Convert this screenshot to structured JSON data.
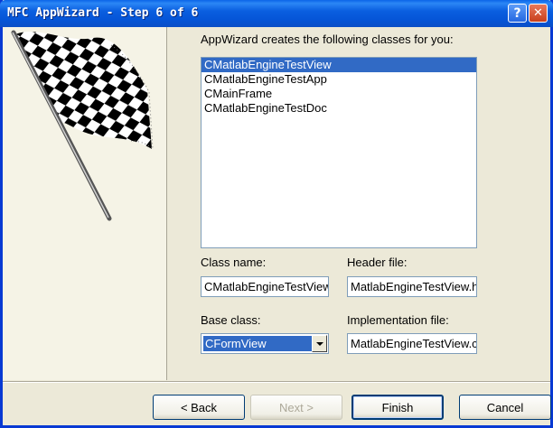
{
  "window": {
    "title": "MFC AppWizard - Step 6 of 6",
    "help_glyph": "?",
    "close_glyph": "✕"
  },
  "main": {
    "intro_text": "AppWizard creates the following classes for you:",
    "classes": [
      {
        "name": "CMatlabEngineTestView",
        "selected": true
      },
      {
        "name": "CMatlabEngineTestApp",
        "selected": false
      },
      {
        "name": "CMainFrame",
        "selected": false
      },
      {
        "name": "CMatlabEngineTestDoc",
        "selected": false
      }
    ],
    "class_name_label": "Class name:",
    "class_name_value": "CMatlabEngineTestView",
    "header_file_label": "Header file:",
    "header_file_value": "MatlabEngineTestView.h",
    "base_class_label": "Base class:",
    "base_class_value": "CFormView",
    "implementation_file_label": "Implementation file:",
    "implementation_file_value": "MatlabEngineTestView.cpp"
  },
  "buttons": {
    "back": "< Back",
    "next": "Next >",
    "finish": "Finish",
    "cancel": "Cancel"
  },
  "colors": {
    "title_bar": "#0a5fe0",
    "selection": "#316ac5",
    "dialog_bg": "#ece9d8"
  }
}
